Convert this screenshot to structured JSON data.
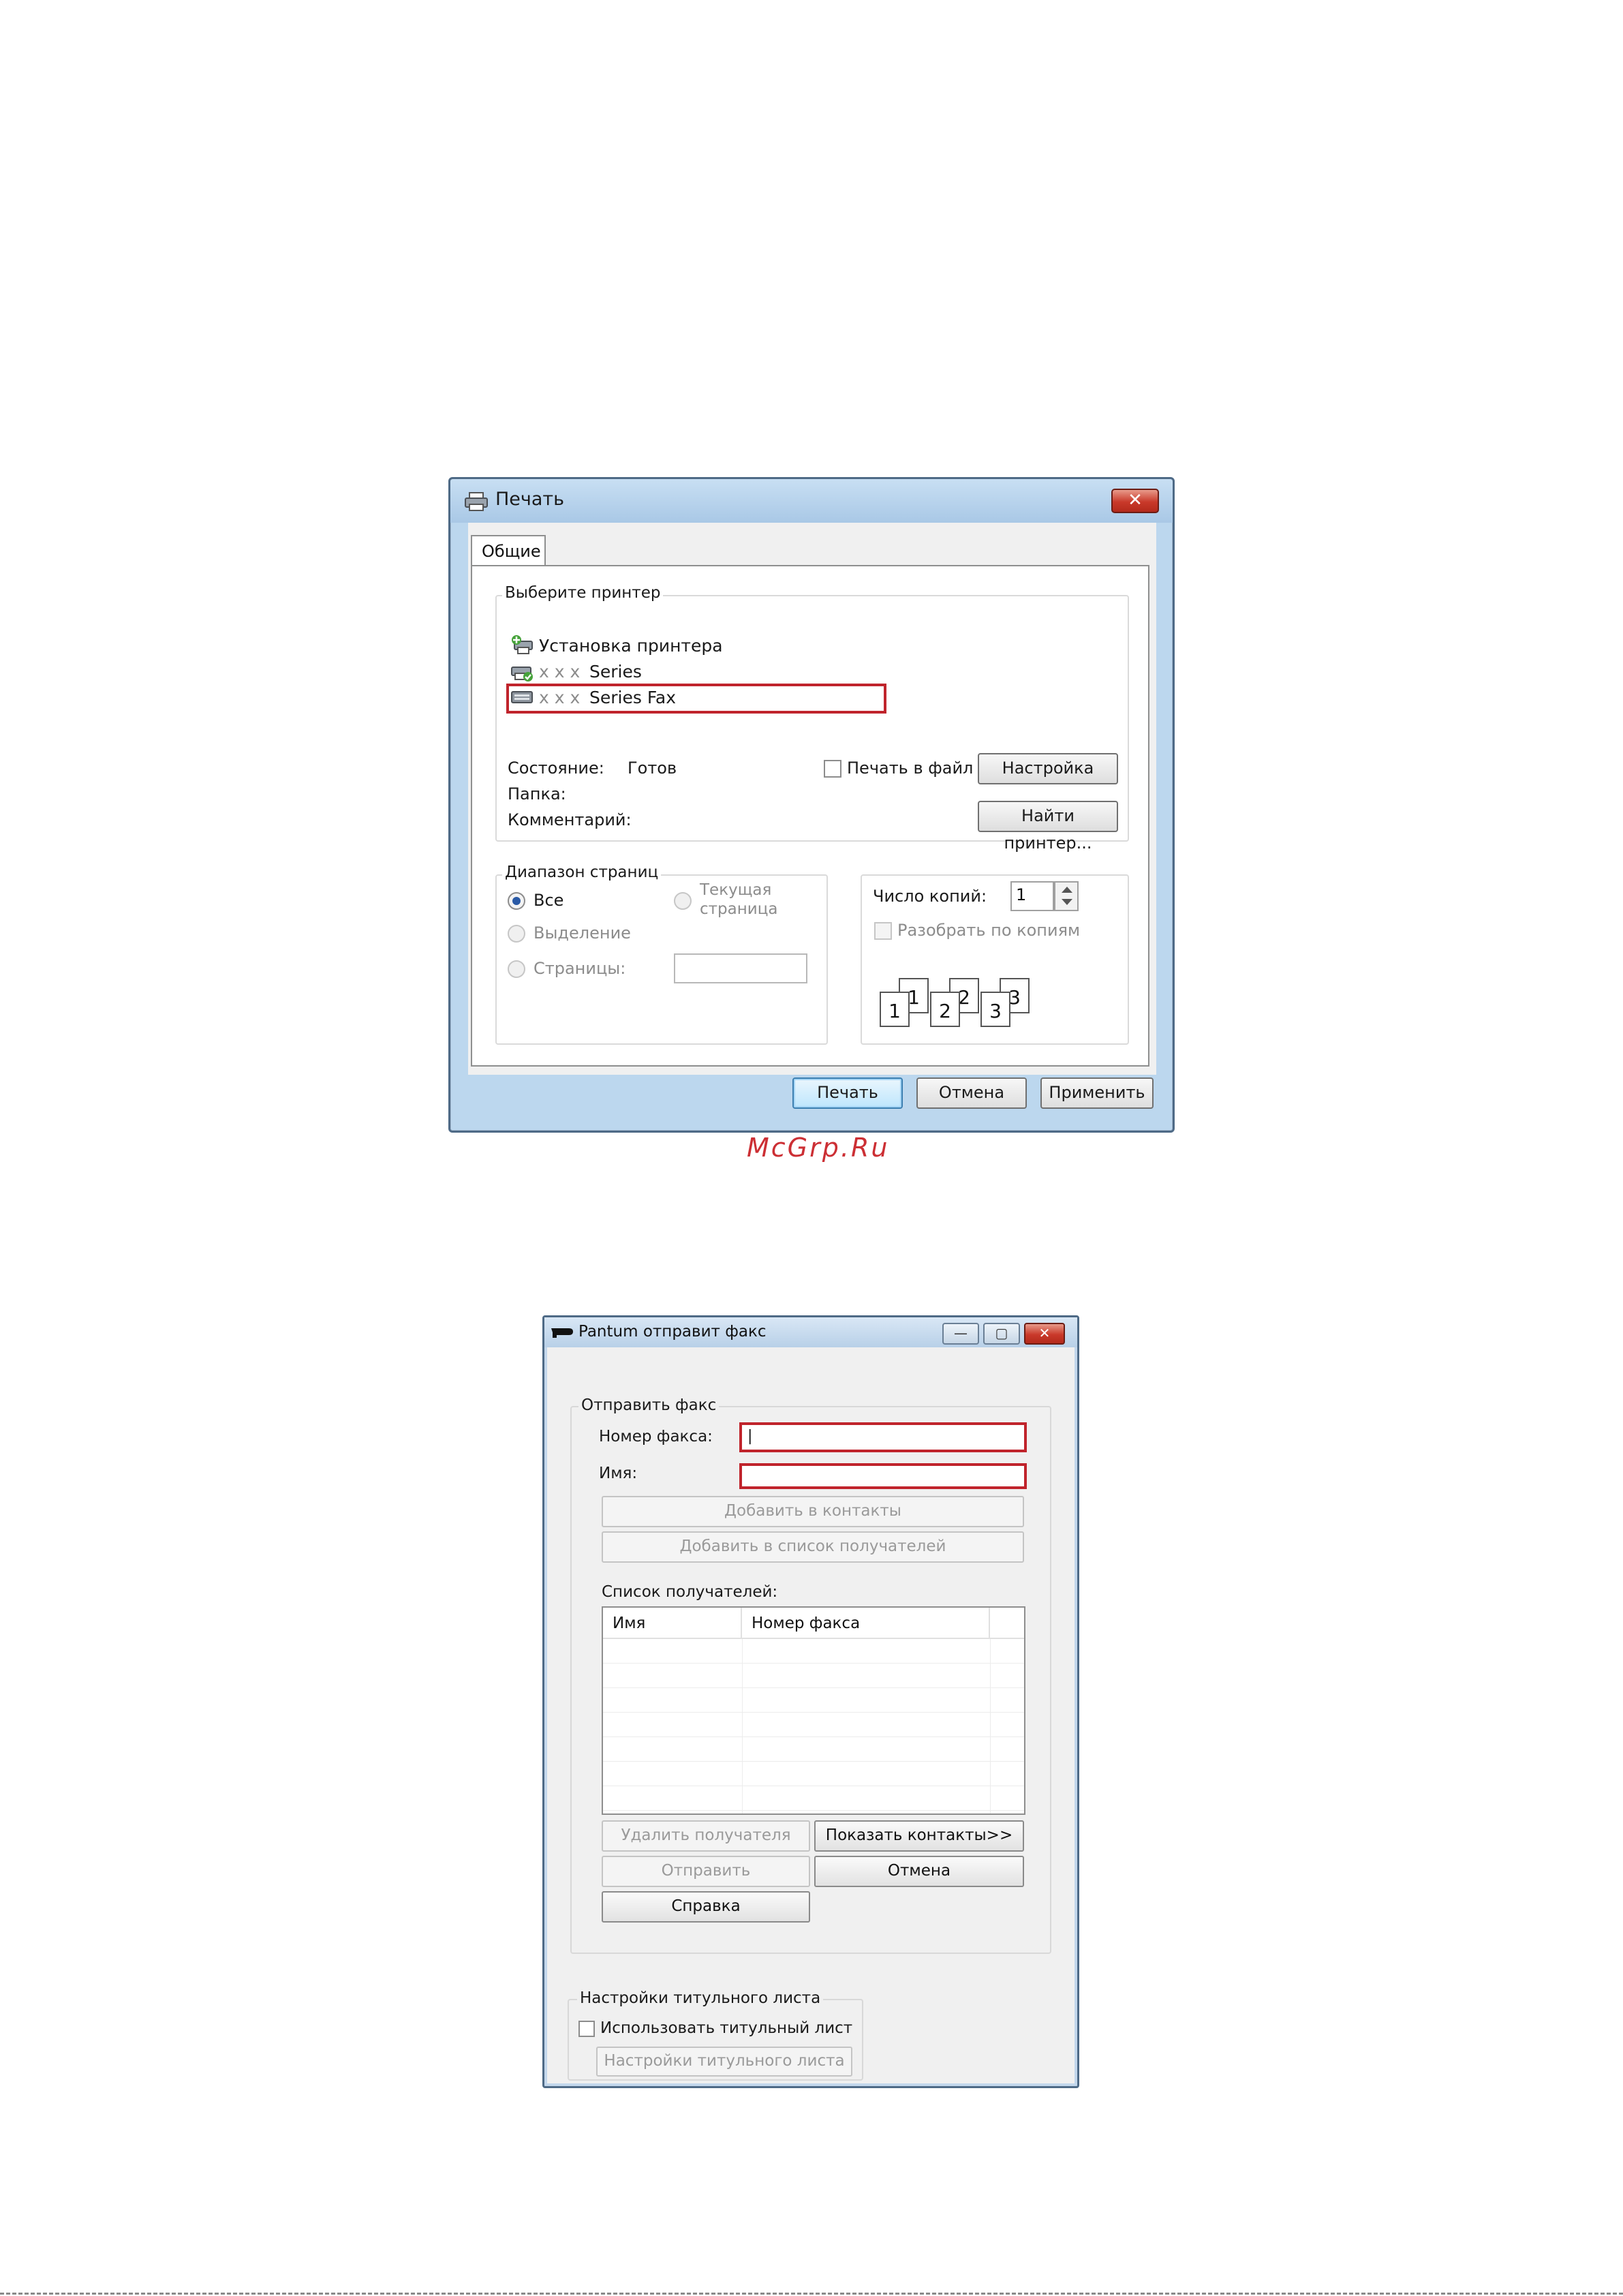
{
  "print_dialog": {
    "title": "Печать",
    "close_label": "✕",
    "tab_general": "Общие",
    "select_printer": {
      "legend": "Выберите принтер",
      "printers": [
        {
          "name": "Установка принтера",
          "prefix": ""
        },
        {
          "prefix": "x x x",
          "name": "Series"
        },
        {
          "prefix": "x x x",
          "name": "Series Fax",
          "selected": true
        }
      ]
    },
    "status_label": "Состояние:",
    "status_value": "Готов",
    "folder_label": "Папка:",
    "comment_label": "Комментарий:",
    "print_to_file": "Печать в файл",
    "settings_button": "Настройка",
    "find_printer_button": "Найти принтер...",
    "page_range": {
      "legend": "Диапазон страниц",
      "all": "Все",
      "current_page_line1": "Текущая",
      "current_page_line2": "страница",
      "selection": "Выделение",
      "pages": "Страницы:"
    },
    "copies": {
      "label": "Число копий:",
      "value": "1",
      "collate": "Разобрать по копиям",
      "pages_illustration": [
        "1",
        "2",
        "3"
      ]
    },
    "buttons": {
      "print": "Печать",
      "cancel": "Отмена",
      "apply": "Применить"
    }
  },
  "watermark": "McGrp.Ru",
  "fax_dialog": {
    "title": "Pantum отправит факс",
    "window_buttons": {
      "minimize": "—",
      "maximize": "▢",
      "close": "✕"
    },
    "send_fax": {
      "legend": "Отправить факс",
      "fax_number_label": "Номер факса:",
      "fax_number_value": "|",
      "name_label": "Имя:",
      "name_value": "",
      "add_to_contacts": "Добавить в контакты",
      "add_to_recipients": "Добавить в список получателей",
      "recipient_list_label": "Список получателей:",
      "columns": [
        "Имя",
        "Номер факса"
      ],
      "delete_recipient": "Удалить получателя",
      "show_contacts": "Показать контакты>>",
      "send": "Отправить",
      "cancel": "Отмена",
      "help": "Справка"
    },
    "cover_page": {
      "legend": "Настройки титульного листа",
      "use_cover_page": "Использовать титульный лист",
      "cover_settings_button": "Настройки титульного листа"
    }
  }
}
